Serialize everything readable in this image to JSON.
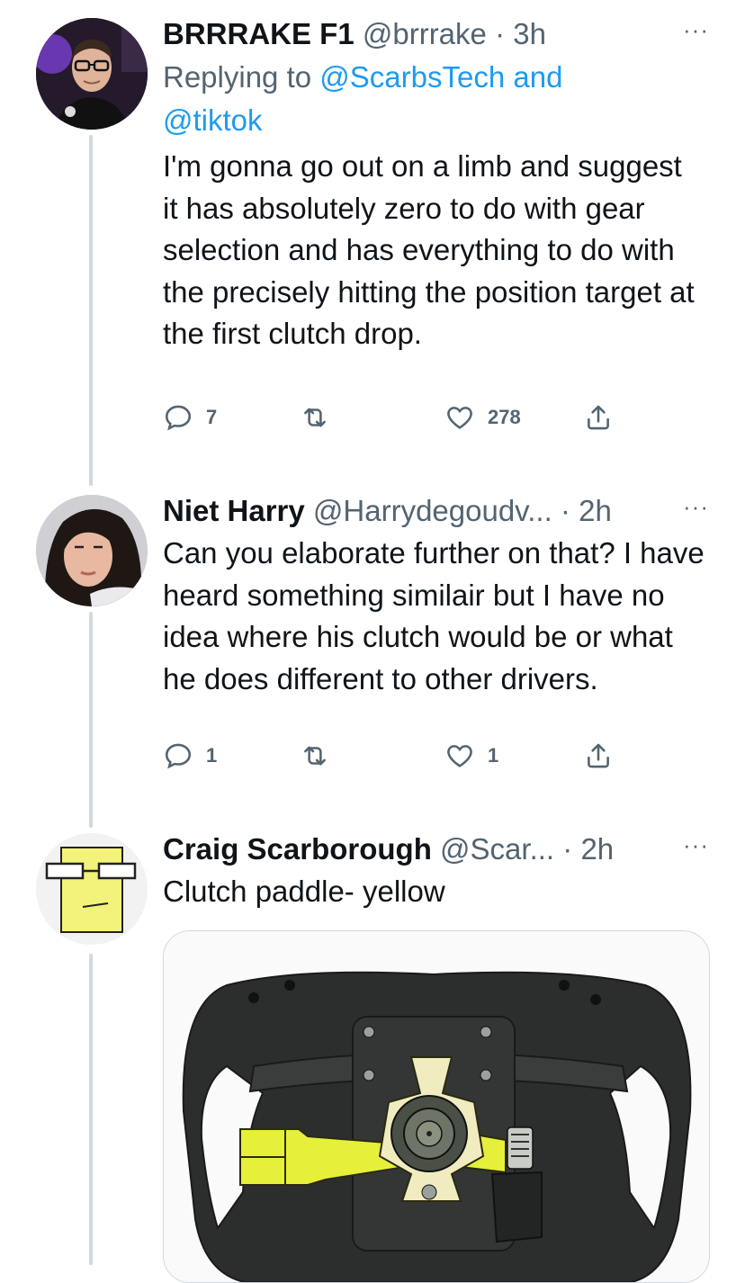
{
  "tweets": [
    {
      "name": "BRRRAKE F1",
      "handle": "@brrrake",
      "dot": "·",
      "time": "3h",
      "more": "···",
      "reply_label": "Replying to",
      "reply_mention_1": "@ScarbsTech",
      "reply_and": "and",
      "reply_mention_2": "@tiktok",
      "text": "I'm gonna go out on a limb and suggest it has absolutely zero to do with gear selection and has everything to do with the precisely hitting the position target at the first clutch drop.",
      "replies": "7",
      "retweets": "",
      "likes": "278"
    },
    {
      "name": "Niet Harry",
      "handle": "@Harrydegoudv...",
      "dot": "·",
      "time": "2h",
      "more": "···",
      "text": "Can you elaborate further on that? I have heard something similair but I have no idea where his clutch would be or what he does different to other drivers.",
      "replies": "1",
      "retweets": "",
      "likes": "1"
    },
    {
      "name": "Craig Scarborough",
      "handle": "@Scar...",
      "dot": "·",
      "time": "2h",
      "more": "···",
      "text": "Clutch paddle- yellow"
    }
  ],
  "colors": {
    "text": "#0f1419",
    "secondary": "#536471",
    "link": "#1d9bf0",
    "thread_line": "#cfd9de",
    "clutch_paddle": "#e6f03a"
  }
}
